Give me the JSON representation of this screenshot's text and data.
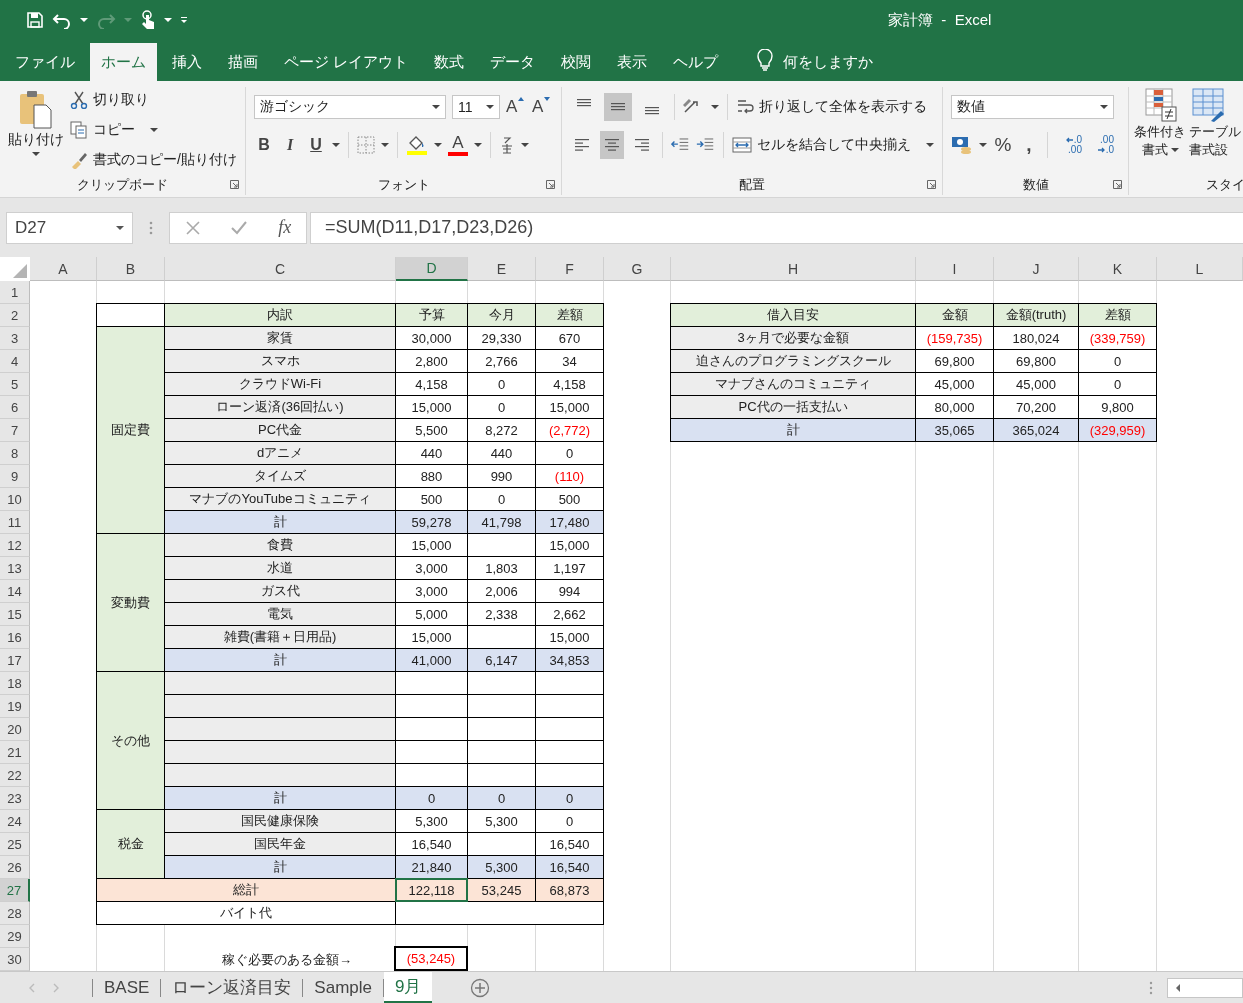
{
  "window": {
    "title": "家計簿  -  Excel"
  },
  "ribbon_tabs": [
    {
      "label": "ファイル",
      "selected": false
    },
    {
      "label": "ホーム",
      "selected": true
    },
    {
      "label": "挿入",
      "selected": false
    },
    {
      "label": "描画",
      "selected": false
    },
    {
      "label": "ページ レイアウト",
      "selected": false
    },
    {
      "label": "数式",
      "selected": false
    },
    {
      "label": "データ",
      "selected": false
    },
    {
      "label": "校閲",
      "selected": false
    },
    {
      "label": "表示",
      "selected": false
    },
    {
      "label": "ヘルプ",
      "selected": false
    }
  ],
  "tell_me": "何をしますか",
  "ribbon": {
    "clipboard": {
      "label": "クリップボード",
      "paste": "貼り付け",
      "cut": "切り取り",
      "copy": "コピー",
      "format_painter": "書式のコピー/貼り付け"
    },
    "font": {
      "label": "フォント",
      "font_name": "游ゴシック",
      "font_size": "11",
      "grow": "A",
      "shrink": "A",
      "bold": "B",
      "italic": "I",
      "underline": "U",
      "font_color": "A"
    },
    "alignment": {
      "label": "配置",
      "vertical": [
        {
          "selected": false
        },
        {
          "selected": true
        },
        {
          "selected": false
        }
      ],
      "horizontal": [
        {
          "selected": false
        },
        {
          "selected": true
        },
        {
          "selected": false
        }
      ],
      "wrap_text": "折り返して全体を表示する",
      "merge_center": "セルを結合して中央揃え"
    },
    "number": {
      "label": "数値",
      "format": "数値",
      "percent": "%",
      "comma": ",",
      "decimal_increase": [
        ".0",
        ".00"
      ],
      "decimal_decrease": [
        ".00",
        ".0"
      ]
    },
    "styles": {
      "label": "スタイ",
      "conditional_formatting": [
        "条件付き",
        "書式"
      ],
      "table_format": [
        "テーブル",
        "書式設"
      ]
    }
  },
  "formula_bar": {
    "name_box": "D27",
    "fx": "fx",
    "formula": "=SUM(D11,D17,D23,D26)"
  },
  "column_headers": [
    {
      "label": "A",
      "selected": false
    },
    {
      "label": "B",
      "selected": false
    },
    {
      "label": "C",
      "selected": false
    },
    {
      "label": "D",
      "selected": true
    },
    {
      "label": "E",
      "selected": false
    },
    {
      "label": "F",
      "selected": false
    },
    {
      "label": "G",
      "selected": false
    },
    {
      "label": "H",
      "selected": false
    },
    {
      "label": "I",
      "selected": false
    },
    {
      "label": "J",
      "selected": false
    },
    {
      "label": "K",
      "selected": false
    },
    {
      "label": "L",
      "selected": false
    }
  ],
  "row_numbers": [
    {
      "label": "1",
      "selected": false
    },
    {
      "label": "2",
      "selected": false
    },
    {
      "label": "3",
      "selected": false
    },
    {
      "label": "4",
      "selected": false
    },
    {
      "label": "5",
      "selected": false
    },
    {
      "label": "6",
      "selected": false
    },
    {
      "label": "7",
      "selected": false
    },
    {
      "label": "8",
      "selected": false
    },
    {
      "label": "9",
      "selected": false
    },
    {
      "label": "10",
      "selected": false
    },
    {
      "label": "11",
      "selected": false
    },
    {
      "label": "12",
      "selected": false
    },
    {
      "label": "13",
      "selected": false
    },
    {
      "label": "14",
      "selected": false
    },
    {
      "label": "15",
      "selected": false
    },
    {
      "label": "16",
      "selected": false
    },
    {
      "label": "17",
      "selected": false
    },
    {
      "label": "18",
      "selected": false
    },
    {
      "label": "19",
      "selected": false
    },
    {
      "label": "20",
      "selected": false
    },
    {
      "label": "21",
      "selected": false
    },
    {
      "label": "22",
      "selected": false
    },
    {
      "label": "23",
      "selected": false
    },
    {
      "label": "24",
      "selected": false
    },
    {
      "label": "25",
      "selected": false
    },
    {
      "label": "26",
      "selected": false
    },
    {
      "label": "27",
      "selected": true
    },
    {
      "label": "28",
      "selected": false
    },
    {
      "label": "29",
      "selected": false
    },
    {
      "label": "30",
      "selected": false
    }
  ],
  "budget": {
    "columns": [
      "内訳",
      "予算",
      "今月",
      "差額"
    ],
    "sections": [
      {
        "name": "固定費",
        "items": [
          {
            "kind": "entry",
            "label": "家賃",
            "budget": {
              "text": "30,000",
              "negative": false
            },
            "this_month": {
              "text": "29,330",
              "negative": false
            },
            "diff": {
              "text": "670",
              "negative": false
            }
          },
          {
            "kind": "entry",
            "label": "スマホ",
            "budget": {
              "text": "2,800",
              "negative": false
            },
            "this_month": {
              "text": "2,766",
              "negative": false
            },
            "diff": {
              "text": "34",
              "negative": false
            }
          },
          {
            "kind": "entry",
            "label": "クラウドWi-Fi",
            "budget": {
              "text": "4,158",
              "negative": false
            },
            "this_month": {
              "text": "0",
              "negative": false
            },
            "diff": {
              "text": "4,158",
              "negative": false
            }
          },
          {
            "kind": "entry",
            "label": "ローン返済(36回払い)",
            "budget": {
              "text": "15,000",
              "negative": false
            },
            "this_month": {
              "text": "0",
              "negative": false
            },
            "diff": {
              "text": "15,000",
              "negative": false
            }
          },
          {
            "kind": "entry",
            "label": "PC代金",
            "budget": {
              "text": "5,500",
              "negative": false
            },
            "this_month": {
              "text": "8,272",
              "negative": false
            },
            "diff": {
              "text": "(2,772)",
              "negative": true
            }
          },
          {
            "kind": "entry",
            "label": "dアニメ",
            "budget": {
              "text": "440",
              "negative": false
            },
            "this_month": {
              "text": "440",
              "negative": false
            },
            "diff": {
              "text": "0",
              "negative": false
            }
          },
          {
            "kind": "entry",
            "label": "タイムズ",
            "budget": {
              "text": "880",
              "negative": false
            },
            "this_month": {
              "text": "990",
              "negative": false
            },
            "diff": {
              "text": "(110)",
              "negative": true
            }
          },
          {
            "kind": "entry",
            "label": "マナブのYouTubeコミュニティ",
            "budget": {
              "text": "500",
              "negative": false
            },
            "this_month": {
              "text": "0",
              "negative": false
            },
            "diff": {
              "text": "500",
              "negative": false
            }
          }
        ],
        "total": {
          "label": "計",
          "budget": {
            "text": "59,278",
            "negative": false
          },
          "this_month": {
            "text": "41,798",
            "negative": false
          },
          "diff": {
            "text": "17,480",
            "negative": false
          }
        }
      },
      {
        "name": "変動費",
        "items": [
          {
            "kind": "entry",
            "label": "食費",
            "budget": {
              "text": "15,000",
              "negative": false
            },
            "diff": {
              "text": "15,000",
              "negative": false
            }
          },
          {
            "kind": "entry",
            "label": "水道",
            "budget": {
              "text": "3,000",
              "negative": false
            },
            "this_month": {
              "text": "1,803",
              "negative": false
            },
            "diff": {
              "text": "1,197",
              "negative": false
            }
          },
          {
            "kind": "entry",
            "label": "ガス代",
            "budget": {
              "text": "3,000",
              "negative": false
            },
            "this_month": {
              "text": "2,006",
              "negative": false
            },
            "diff": {
              "text": "994",
              "negative": false
            }
          },
          {
            "kind": "entry",
            "label": "電気",
            "budget": {
              "text": "5,000",
              "negative": false
            },
            "this_month": {
              "text": "2,338",
              "negative": false
            },
            "diff": {
              "text": "2,662",
              "negative": false
            }
          },
          {
            "kind": "entry",
            "label": "雑費(書籍＋日用品)",
            "budget": {
              "text": "15,000",
              "negative": false
            },
            "diff": {
              "text": "15,000",
              "negative": false
            }
          }
        ],
        "total": {
          "label": "計",
          "budget": {
            "text": "41,000",
            "negative": false
          },
          "this_month": {
            "text": "6,147",
            "negative": false
          },
          "diff": {
            "text": "34,853",
            "negative": false
          }
        }
      },
      {
        "name": "その他",
        "items": [
          {
            "kind": "blank"
          },
          {
            "kind": "blank"
          },
          {
            "kind": "blank"
          },
          {
            "kind": "blank"
          },
          {
            "kind": "blank"
          }
        ],
        "total": {
          "label": "計",
          "budget": {
            "text": "0",
            "negative": false
          },
          "this_month": {
            "text": "0",
            "negative": false
          },
          "diff": {
            "text": "0",
            "negative": false
          }
        }
      },
      {
        "name": "税金",
        "items": [
          {
            "kind": "entry",
            "label": "国民健康保険",
            "budget": {
              "text": "5,300",
              "negative": false
            },
            "this_month": {
              "text": "5,300",
              "negative": false
            },
            "diff": {
              "text": "0",
              "negative": false
            }
          },
          {
            "kind": "entry",
            "label": "国民年金",
            "budget": {
              "text": "16,540",
              "negative": false
            },
            "diff": {
              "text": "16,540",
              "negative": false
            }
          }
        ],
        "total": {
          "label": "計",
          "budget": {
            "text": "21,840",
            "negative": false
          },
          "this_month": {
            "text": "5,300",
            "negative": false
          },
          "diff": {
            "text": "16,540",
            "negative": false
          }
        }
      }
    ],
    "grand_total": {
      "label": "総計",
      "budget": {
        "text": "122,118",
        "negative": false
      },
      "this_month": {
        "text": "53,245",
        "negative": false
      },
      "diff": {
        "text": "68,873",
        "negative": false
      }
    },
    "part_time": {
      "label": "バイト代"
    },
    "needed": {
      "label": "稼ぐ必要のある金額→",
      "value": {
        "text": "(53,245)",
        "negative": true
      }
    }
  },
  "loan": {
    "columns": [
      "借入目安",
      "金額",
      "金額(truth)",
      "差額"
    ],
    "items": [
      {
        "label": "3ヶ月で必要な金額",
        "amount": {
          "text": "(159,735)",
          "negative": true
        },
        "amount_truth": {
          "text": "180,024",
          "negative": false
        },
        "diff": {
          "text": "(339,759)",
          "negative": true
        }
      },
      {
        "label": "迫さんのプログラミングスクール",
        "amount": {
          "text": "69,800",
          "negative": false
        },
        "amount_truth": {
          "text": "69,800",
          "negative": false
        },
        "diff": {
          "text": "0",
          "negative": false
        }
      },
      {
        "label": "マナブさんのコミュニティ",
        "amount": {
          "text": "45,000",
          "negative": false
        },
        "amount_truth": {
          "text": "45,000",
          "negative": false
        },
        "diff": {
          "text": "0",
          "negative": false
        }
      },
      {
        "label": "PC代の一括支払い",
        "amount": {
          "text": "80,000",
          "negative": false
        },
        "amount_truth": {
          "text": "70,200",
          "negative": false
        },
        "diff": {
          "text": "9,800",
          "negative": false
        }
      }
    ],
    "total": {
      "label": "計",
      "amount": {
        "text": "35,065",
        "negative": false
      },
      "amount_truth": {
        "text": "365,024",
        "negative": false
      },
      "diff": {
        "text": "(329,959)",
        "negative": true
      }
    }
  },
  "sheet_tabs": [
    {
      "label": "BASE",
      "selected": false
    },
    {
      "label": "ローン返済目安",
      "selected": false
    },
    {
      "label": "Sample",
      "selected": false
    },
    {
      "label": "9月",
      "selected": true
    }
  ]
}
